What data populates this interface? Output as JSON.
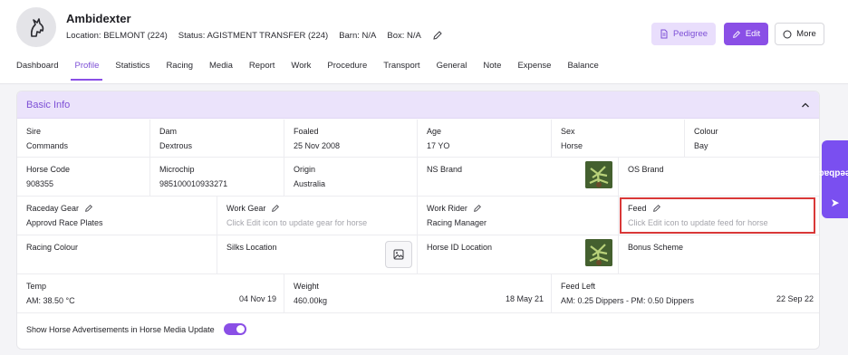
{
  "horse": {
    "name": "Ambidexter",
    "location": "Location: BELMONT (224)",
    "status": "Status: AGISTMENT TRANSFER (224)",
    "barn": "Barn: N/A",
    "box": "Box: N/A"
  },
  "actions": {
    "pedigree": "Pedigree",
    "edit": "Edit",
    "more": "More"
  },
  "tabs": [
    "Dashboard",
    "Profile",
    "Statistics",
    "Racing",
    "Media",
    "Report",
    "Work",
    "Procedure",
    "Transport",
    "General",
    "Note",
    "Expense",
    "Balance"
  ],
  "active_tab": "Profile",
  "card": {
    "title": "Basic Info"
  },
  "row1": [
    {
      "label": "Sire",
      "value": "Commands"
    },
    {
      "label": "Dam",
      "value": "Dextrous"
    },
    {
      "label": "Foaled",
      "value": "25 Nov 2008"
    },
    {
      "label": "Age",
      "value": "17 YO"
    },
    {
      "label": "Sex",
      "value": "Horse"
    },
    {
      "label": "Colour",
      "value": "Bay"
    }
  ],
  "row2": [
    {
      "label": "Horse Code",
      "value": "908355"
    },
    {
      "label": "Microchip",
      "value": "985100010933271"
    },
    {
      "label": "Origin",
      "value": "Australia"
    },
    {
      "label": "NS Brand",
      "value": ""
    },
    {
      "label": "OS Brand",
      "value": ""
    }
  ],
  "row3": [
    {
      "label": "Raceday Gear",
      "value": "Approvd Race Plates"
    },
    {
      "label": "Work Gear",
      "value": "Click Edit icon to update gear for horse"
    },
    {
      "label": "Work Rider",
      "value": "Racing Manager"
    },
    {
      "label": "Feed",
      "value": "Click Edit icon to update feed for horse"
    }
  ],
  "row4": [
    {
      "label": "Racing Colour"
    },
    {
      "label": "Silks Location"
    },
    {
      "label": "Horse ID Location"
    },
    {
      "label": "Bonus Scheme"
    }
  ],
  "row5": [
    {
      "label": "Temp",
      "value": "AM: 38.50 °C",
      "date": "04 Nov 19"
    },
    {
      "label": "Weight",
      "value": "460.00kg",
      "date": "18 May 21"
    },
    {
      "label": "Feed Left",
      "value": "AM: 0.25 Dippers - PM: 0.50 Dippers",
      "date": "22 Sep 22"
    }
  ],
  "toggle_label": "Show Horse Advertisements in Horse Media Update",
  "toggle_on": true,
  "feedback": "Feedback",
  "colors": {
    "accent": "#8a4fe6",
    "header_bg": "#ebe3fb",
    "highlight": "#d93838"
  }
}
